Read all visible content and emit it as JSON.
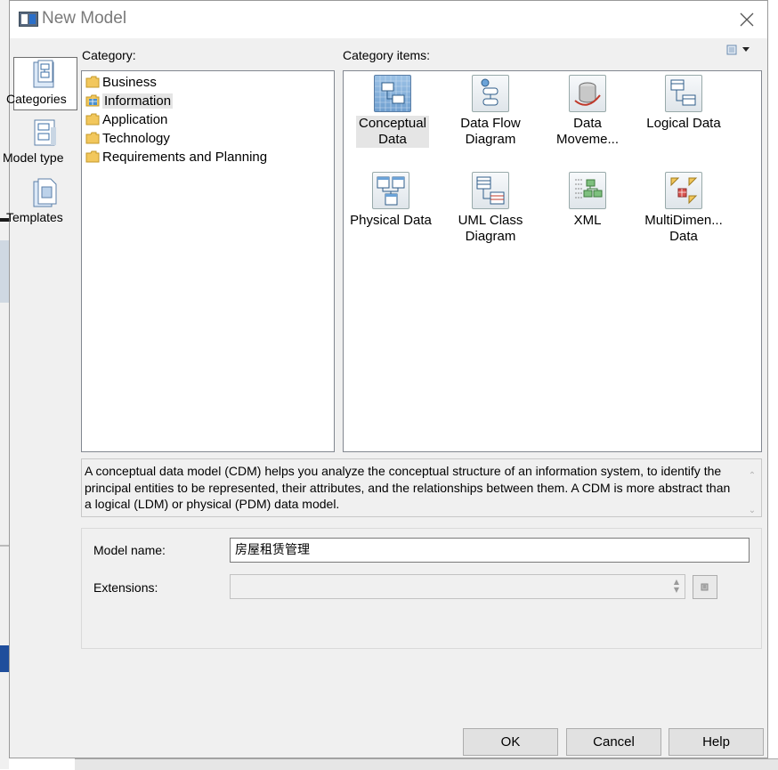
{
  "window": {
    "title": "New Model"
  },
  "nav": {
    "items": [
      {
        "label": "Categories",
        "icon": "categories-icon",
        "selected": true
      },
      {
        "label": "Model type",
        "icon": "model-type-icon",
        "selected": false
      },
      {
        "label": "Templates",
        "icon": "templates-icon",
        "selected": false
      }
    ]
  },
  "category": {
    "label": "Category:",
    "items": [
      {
        "label": "Business",
        "icon": "folder-icon"
      },
      {
        "label": "Information",
        "icon": "information-icon",
        "selected": true
      },
      {
        "label": "Application",
        "icon": "folder-icon"
      },
      {
        "label": "Technology",
        "icon": "folder-icon"
      },
      {
        "label": "Requirements and Planning",
        "icon": "folder-icon"
      }
    ]
  },
  "category_items": {
    "label": "Category items:",
    "items": [
      {
        "line1": "Conceptual",
        "line2": "Data",
        "icon": "conceptual-data-icon",
        "selected": true
      },
      {
        "line1": "Data Flow",
        "line2": "Diagram",
        "icon": "data-flow-diagram-icon"
      },
      {
        "line1": "Data",
        "line2": "Moveme...",
        "icon": "data-movement-icon"
      },
      {
        "line1": "Logical Data",
        "line2": "",
        "icon": "logical-data-icon"
      },
      {
        "line1": "Physical Data",
        "line2": "",
        "icon": "physical-data-icon"
      },
      {
        "line1": "UML Class",
        "line2": "Diagram",
        "icon": "uml-class-diagram-icon"
      },
      {
        "line1": "XML",
        "line2": "",
        "icon": "xml-icon"
      },
      {
        "line1": "MultiDimen...",
        "line2": "Data",
        "icon": "multidimensional-data-icon"
      }
    ]
  },
  "description": "A conceptual data model (CDM) helps you analyze the conceptual structure of an information system, to identify the principal entities to be represented, their attributes, and the relationships between them. A CDM is more abstract than a logical (LDM) or physical (PDM) data model.",
  "form": {
    "model_name_label": "Model name:",
    "model_name_value": "房屋租赁管理",
    "extensions_label": "Extensions:",
    "extensions_value": ""
  },
  "buttons": {
    "ok": "OK",
    "cancel": "Cancel",
    "help": "Help"
  },
  "colors": {
    "dialog_bg": "#f0f0f0",
    "selection": "#e5e5e5",
    "folder": "#f0c050"
  }
}
